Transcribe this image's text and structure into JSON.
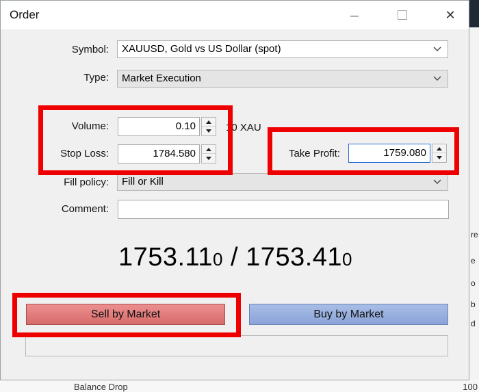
{
  "window": {
    "title": "Order",
    "close_glyph": "✕"
  },
  "form": {
    "symbol_label": "Symbol:",
    "symbol_value": "XAUUSD, Gold vs US Dollar (spot)",
    "type_label": "Type:",
    "type_value": "Market Execution",
    "volume_label": "Volume:",
    "volume_value": "0.10",
    "volume_unit": "10 XAU",
    "stop_loss_label": "Stop Loss:",
    "stop_loss_value": "1784.580",
    "take_profit_label": "Take Profit:",
    "take_profit_value": "1759.080",
    "fill_policy_label": "Fill policy:",
    "fill_policy_value": "Fill or Kill",
    "comment_label": "Comment:",
    "comment_value": ""
  },
  "quote": {
    "bid_main": "1753.11",
    "bid_small": "0",
    "separator": " / ",
    "ask_main": "1753.41",
    "ask_small": "0"
  },
  "buttons": {
    "sell_label": "Sell by Market",
    "buy_label": "Buy by Market"
  },
  "background": {
    "right_bits": [
      "re",
      "e",
      "o",
      "b",
      "d"
    ],
    "bottom_text": "Balance Drop",
    "bottom_right": "100"
  },
  "colors": {
    "highlight": "#ee0000",
    "sell_button": "#e07a7a",
    "buy_button": "#9ab0df",
    "focus_border": "#2a6fd6"
  }
}
